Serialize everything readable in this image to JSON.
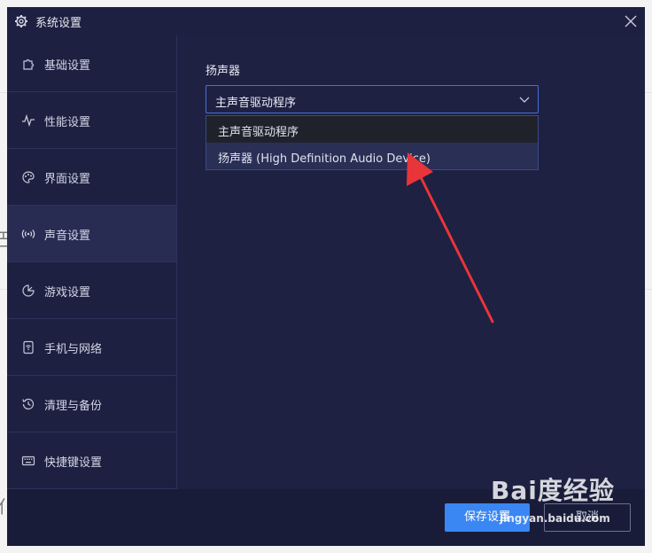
{
  "window": {
    "title": "系统设置",
    "title_icon": "gear-icon",
    "close_icon": "close-icon"
  },
  "sidebar": {
    "items": [
      {
        "label": "基础设置",
        "icon": "puzzle-icon"
      },
      {
        "label": "性能设置",
        "icon": "pulse-icon"
      },
      {
        "label": "界面设置",
        "icon": "palette-icon"
      },
      {
        "label": "声音设置",
        "icon": "sound-icon"
      },
      {
        "label": "游戏设置",
        "icon": "gamepad-icon"
      },
      {
        "label": "手机与网络",
        "icon": "phone-wifi-icon"
      },
      {
        "label": "清理与备份",
        "icon": "history-icon"
      },
      {
        "label": "快捷键设置",
        "icon": "keyboard-icon"
      }
    ],
    "active": "声音设置"
  },
  "main": {
    "speaker_label": "扬声器",
    "speaker_select": {
      "value": "主声音驱动程序"
    },
    "speaker_options": [
      "主声音驱动程序",
      "扬声器 (High Definition Audio Device)"
    ]
  },
  "footer": {
    "save_label": "保存设置",
    "cancel_label": "取消"
  },
  "watermark": {
    "text": "Bai度经验",
    "url": "jingyan.baidu.com"
  },
  "colors": {
    "dialog_bg": "#1d2040",
    "accent": "#3a86f2",
    "select_border": "#4a6fd8",
    "annotation_arrow": "#e8353a"
  }
}
